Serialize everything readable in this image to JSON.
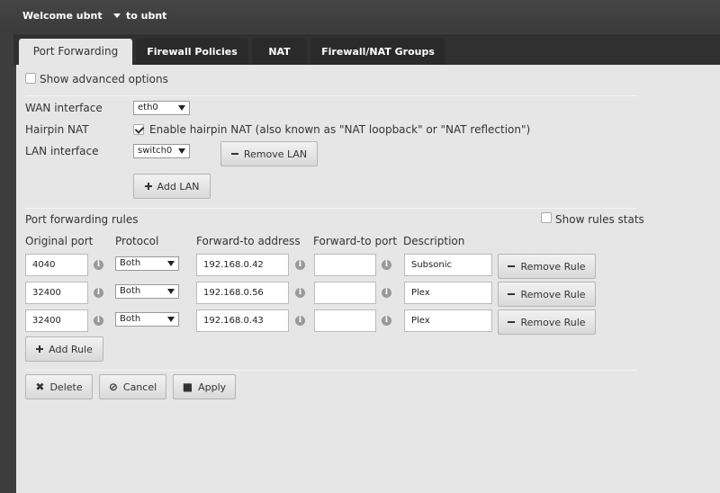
{
  "topbar": {
    "welcome": "Welcome ubnt",
    "target": "to ubnt"
  },
  "tabs": [
    {
      "label": "Port Forwarding",
      "active": true
    },
    {
      "label": "Firewall Policies",
      "active": false
    },
    {
      "label": "NAT",
      "active": false
    },
    {
      "label": "Firewall/NAT Groups",
      "active": false
    }
  ],
  "options": {
    "show_advanced": "Show advanced options",
    "show_advanced_checked": false
  },
  "wan": {
    "label": "WAN interface",
    "value": "eth0"
  },
  "hairpin": {
    "label": "Hairpin NAT",
    "checkbox_label": "Enable hairpin NAT (also known as \"NAT loopback\" or \"NAT reflection\")",
    "checked": true
  },
  "lan": {
    "label": "LAN interface",
    "value": "switch0",
    "remove_label": "Remove LAN",
    "add_label": "Add LAN"
  },
  "rules": {
    "section_label": "Port forwarding rules",
    "show_stats": "Show rules stats",
    "show_stats_checked": false,
    "headers": [
      "Original port",
      "Protocol",
      "Forward-to address",
      "Forward-to port",
      "Description"
    ],
    "rows": [
      {
        "port": "4040",
        "protocol": "Both",
        "address": "192.168.0.42",
        "fport": "",
        "description": "Subsonic",
        "remove": "Remove Rule"
      },
      {
        "port": "32400",
        "protocol": "Both",
        "address": "192.168.0.56",
        "fport": "",
        "description": "Plex",
        "remove": "Remove Rule"
      },
      {
        "port": "32400",
        "protocol": "Both",
        "address": "192.168.0.43",
        "fport": "",
        "description": "Plex",
        "remove": "Remove Rule"
      }
    ],
    "add_label": "Add Rule"
  },
  "actions": {
    "delete": "Delete",
    "cancel": "Cancel",
    "apply": "Apply"
  }
}
